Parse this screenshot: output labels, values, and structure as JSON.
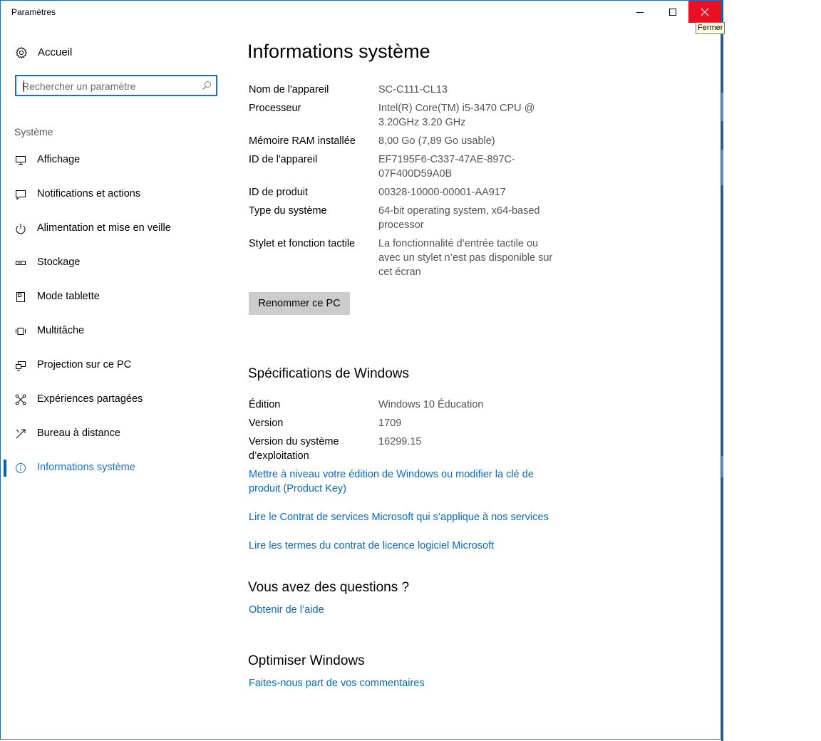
{
  "window": {
    "title": "Paramètres",
    "close_tooltip": "Fermer"
  },
  "nav": {
    "home_label": "Accueil",
    "search_placeholder": "Rechercher un paramètre",
    "section_label": "Système",
    "items": [
      {
        "label": "Affichage",
        "icon": "display-icon"
      },
      {
        "label": "Notifications et actions",
        "icon": "notification-icon"
      },
      {
        "label": "Alimentation et mise en veille",
        "icon": "power-icon"
      },
      {
        "label": "Stockage",
        "icon": "storage-icon"
      },
      {
        "label": "Mode tablette",
        "icon": "tablet-mode-icon"
      },
      {
        "label": "Multitâche",
        "icon": "multitasking-icon"
      },
      {
        "label": "Projection sur ce PC",
        "icon": "projection-icon"
      },
      {
        "label": "Expériences partagées",
        "icon": "shared-experiences-icon"
      },
      {
        "label": "Bureau à distance",
        "icon": "remote-desktop-icon"
      },
      {
        "label": "Informations système",
        "icon": "info-icon",
        "active": true
      }
    ]
  },
  "main": {
    "title": "Informations système",
    "specs": [
      {
        "label": "Nom de l'appareil",
        "value": "SC-C111-CL13"
      },
      {
        "label": "Processeur",
        "value": "Intel(R) Core(TM) i5-3470 CPU @ 3.20GHz   3.20 GHz"
      },
      {
        "label": "Mémoire RAM installée",
        "value": "8,00 Go (7,89 Go usable)"
      },
      {
        "label": "ID de l'appareil",
        "value": "EF7195F6-C337-47AE-897C-07F400D59A0B"
      },
      {
        "label": "ID de produit",
        "value": "00328-10000-00001-AA917"
      },
      {
        "label": "Type du système",
        "value": "64-bit operating system, x64-based processor"
      },
      {
        "label": "Stylet et fonction tactile",
        "value": "La fonctionnalité d’entrée tactile ou avec un stylet n’est pas disponible sur cet écran"
      }
    ],
    "rename_button": "Renommer ce PC",
    "windows_specs_title": "Spécifications de Windows",
    "windows_specs": [
      {
        "label": "Édition",
        "value": "Windows 10 Éducation"
      },
      {
        "label": "Version",
        "value": "1709"
      },
      {
        "label": "Version du système d’exploitation",
        "value": "16299.15"
      }
    ],
    "links": {
      "upgrade": "Mettre à niveau votre édition de Windows ou modifier la clé de produit (Product Key)",
      "services": "Lire le Contrat de services Microsoft qui s’applique à nos services",
      "license": "Lire les termes du contrat de licence logiciel Microsoft"
    },
    "questions_title": "Vous avez des questions ?",
    "help_link": "Obtenir de l’aide",
    "optimize_title": "Optimiser Windows",
    "feedback_link": "Faites-nous part de vos commentaires"
  },
  "colors": {
    "accent": "#0063b1",
    "link": "#0a68c2",
    "close_hover": "#e81123"
  }
}
